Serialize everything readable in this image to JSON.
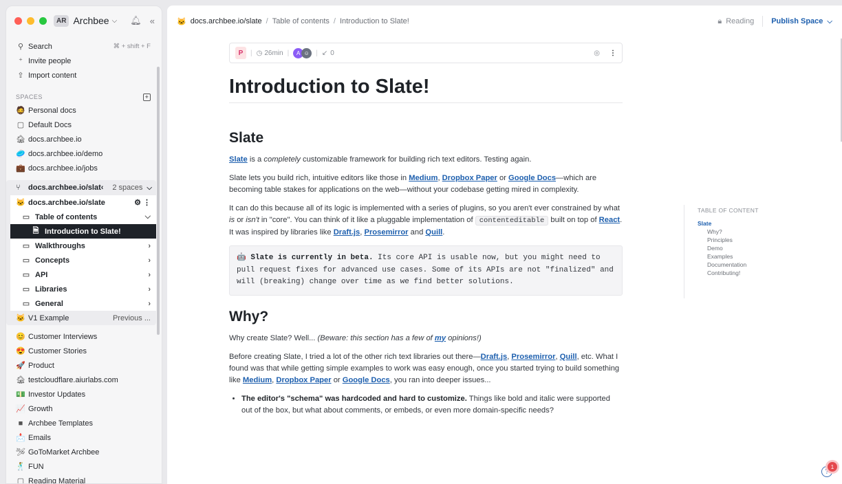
{
  "window": {
    "traffic_lights": [
      "#ff5f57",
      "#febc2e",
      "#28c840"
    ],
    "workspace_initials": "AR",
    "workspace_name": "Archbee"
  },
  "sidebar": {
    "search_label": "Search",
    "search_shortcut": "⌘ + shift + F",
    "invite_label": "Invite people",
    "import_label": "Import content",
    "spaces_label": "SPACES",
    "spaces": [
      {
        "icon": "🧔",
        "label": "Personal docs"
      },
      {
        "icon": "▢",
        "label": "Default Docs"
      },
      {
        "icon": "🏚",
        "label": "docs.archbee.io"
      },
      {
        "icon": "🥏",
        "label": "docs.archbee.io/demo"
      },
      {
        "icon": "💼",
        "label": "docs.archbee.io/jobs"
      }
    ],
    "group": {
      "title": "docs.archbee.io/slat‹",
      "count": "2 spaces",
      "space_name": "docs.archbee.io/slate",
      "space_icon": "🐱",
      "tree": [
        {
          "label": "Table of contents"
        },
        {
          "label": "Introduction to Slate!"
        },
        {
          "label": "Walkthroughs"
        },
        {
          "label": "Concepts"
        },
        {
          "label": "API"
        },
        {
          "label": "Libraries"
        },
        {
          "label": "General"
        }
      ],
      "v1_label": "V1 Example",
      "v1_right": "Previous ..."
    },
    "more_spaces": [
      {
        "icon": "😊",
        "label": "Customer Interviews"
      },
      {
        "icon": "😍",
        "label": "Customer Stories"
      },
      {
        "icon": "🚀",
        "label": "Product"
      },
      {
        "icon": "🏚",
        "label": "testcloudflare.aiurlabs.com"
      },
      {
        "icon": "💵",
        "label": "Investor Updates"
      },
      {
        "icon": "📈",
        "label": "Growth"
      },
      {
        "icon": "■",
        "label": "Archbee Templates"
      },
      {
        "icon": "📩",
        "label": "Emails"
      },
      {
        "icon": "🛩",
        "label": "GoToMarket Archbee"
      },
      {
        "icon": "🕺",
        "label": "FUN"
      },
      {
        "icon": "▢",
        "label": "Reading Material"
      }
    ]
  },
  "topbar": {
    "breadcrumb": [
      "docs.archbee.io/slate",
      "Table of contents",
      "Introduction to Slate!"
    ],
    "reading_label": "Reading",
    "publish_label": "Publish Space"
  },
  "meta": {
    "badge": "P",
    "read_time": "26min",
    "avatar_letter": "A",
    "backlinks": "0"
  },
  "doc": {
    "title": "Introduction to Slate!",
    "h_slate": "Slate",
    "p1": {
      "link": "Slate",
      "a": " is a ",
      "em": "completely",
      "b": " customizable framework for building rich text editors. Testing again."
    },
    "p2": {
      "a": "Slate lets you build rich, intuitive editors like those in ",
      "l1": "Medium",
      "s1": ", ",
      "l2": "Dropbox Paper",
      "s2": " or ",
      "l3": "Google Docs",
      "b": "—which are becoming table stakes for applications on the web—without your codebase getting mired in complexity."
    },
    "p3": {
      "a": "It can do this because all of its logic is implemented with a series of plugins, so you aren't ever constrained by what ",
      "em1": "is",
      "m": " or ",
      "em2": "isn't",
      "b": " in \"core\". You can think of it like a pluggable implementation of ",
      "code": "contenteditable",
      "c": " built on top of ",
      "l1": "React",
      "d": ". It was inspired by libraries like ",
      "l2": "Draft.js",
      "s1": ", ",
      "l3": "Prosemirror",
      "s2": " and ",
      "l4": "Quill",
      "e": "."
    },
    "callout": {
      "icon": "🤖",
      "bold": "Slate is currently in beta.",
      "text": " Its core API is usable now, but you might need to pull request fixes for advanced use cases. Some of its APIs are not \"finalized\" and will (breaking) change over time as we find better solutions."
    },
    "h_why": "Why?",
    "p4": {
      "a": "Why create Slate? Well... ",
      "em1": "(Beware: this section has a few of ",
      "link": "my",
      "em2": " opinions!)"
    },
    "p5": {
      "a": "Before creating Slate, I tried a lot of the other rich text libraries out there—",
      "l1": "Draft.js",
      "s1": ", ",
      "l2": "Prosemirror",
      "s2": ", ",
      "l3": "Quill",
      "b": ", etc. What I found was that while getting simple examples to work was easy enough, once you started trying to build something like ",
      "l4": "Medium",
      "s3": ", ",
      "l5": "Dropbox Paper",
      "s4": " or ",
      "l6": "Google Docs",
      "c": ", you ran into deeper issues..."
    },
    "bullet1": {
      "bold": "The editor's \"schema\" was hardcoded and hard to customize.",
      "text": " Things like bold and italic were supported out of the box, but what about comments, or embeds, or even more domain-specific needs?"
    }
  },
  "toc": {
    "title": "TABLE OF CONTENT",
    "top": "Slate",
    "items": [
      "Why?",
      "Principles",
      "Demo",
      "Examples",
      "Documentation",
      "Contributing!"
    ]
  },
  "help": {
    "badge": "1"
  }
}
